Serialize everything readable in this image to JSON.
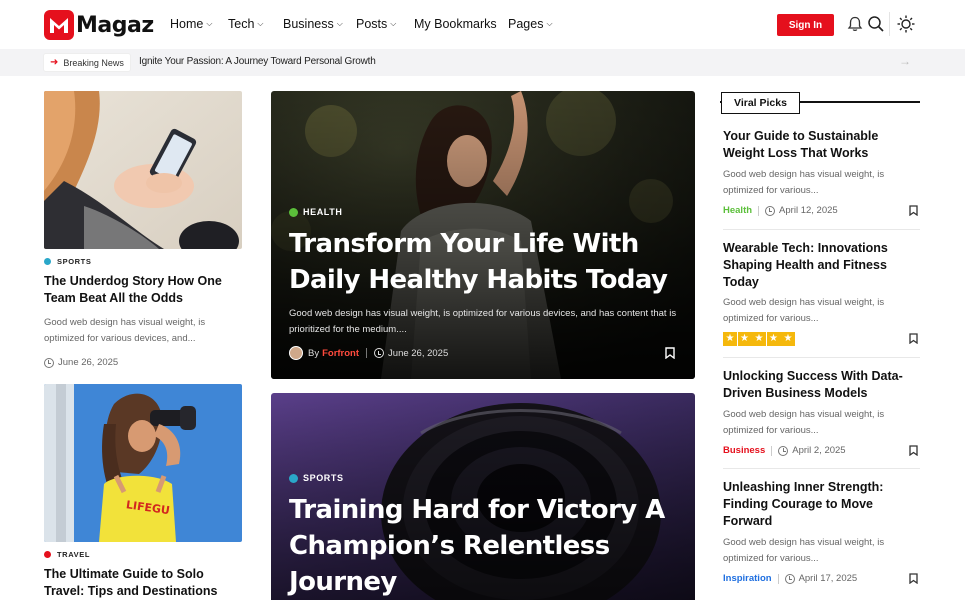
{
  "header": {
    "logo_letter": "M",
    "logo_text": "Magaz",
    "nav": [
      {
        "label": "Home",
        "dropdown": true
      },
      {
        "label": "Tech",
        "dropdown": true
      },
      {
        "label": "Business",
        "dropdown": true
      },
      {
        "label": "Posts",
        "dropdown": true
      },
      {
        "label": "My Bookmarks",
        "dropdown": false
      },
      {
        "label": "Pages",
        "dropdown": true
      }
    ],
    "signin_label": "Sign In",
    "icons": [
      "bell-icon",
      "search-icon",
      "sun-icon"
    ]
  },
  "breaking": {
    "badge": "Breaking News",
    "headline": "Ignite Your Passion: A Journey Toward Personal Growth",
    "icons": [
      "bolt-icon",
      "arrow-right-icon"
    ]
  },
  "left_posts": [
    {
      "category": "SPORTS",
      "category_color": "#2aa7c9",
      "title": "The Underdog Story How One Team Beat All the Odds",
      "excerpt": "Good web design has visual weight, is optimized for various devices, and...",
      "date": "June 26, 2025"
    },
    {
      "category": "TRAVEL",
      "category_color": "#e5101d",
      "title": "The Ultimate Guide to Solo Travel: Tips and Destinations",
      "excerpt": "",
      "date": ""
    }
  ],
  "featured": [
    {
      "category": "HEALTH",
      "category_color": "#5bbf3a",
      "title": "Transform Your Life With Daily Healthy Habits Today",
      "excerpt": "Good web design has visual weight, is optimized for various devices, and has content that is prioritized for the medium....",
      "by": "By",
      "author": "Forfront",
      "date": "June 26, 2025"
    },
    {
      "category": "SPORTS",
      "category_color": "#2aa7c9",
      "title": "Training Hard for Victory A Champion’s Relentless Journey"
    }
  ],
  "viral": {
    "heading": "Viral Picks",
    "items": [
      {
        "title": "Your Guide to Sustainable Weight Loss That Works",
        "excerpt": "Good web design has visual weight, is optimized for various...",
        "category": "Health",
        "category_color": "#5bbf3a",
        "date": "April 12, 2025"
      },
      {
        "title": "Wearable Tech: Innovations Shaping Health and Fitness Today",
        "excerpt": "Good web design has visual weight, is optimized for various...",
        "rating": 5,
        "rating_max": 5
      },
      {
        "title": "Unlocking Success With Data-Driven Business Models",
        "excerpt": "Good web design has visual weight, is optimized for various...",
        "category": "Business",
        "category_color": "#e5101d",
        "date": "April 2, 2025"
      },
      {
        "title": "Unleashing Inner Strength: Finding Courage to Move Forward",
        "excerpt": "Good web design has visual weight, is optimized for various...",
        "category": "Inspiration",
        "category_color": "#1f6fe0",
        "date": "April 17, 2025"
      }
    ]
  },
  "colors": {
    "brand_red": "#e5101d",
    "breaking_bg": "#f3f3f5",
    "star_yellow": "#f5b80c"
  }
}
